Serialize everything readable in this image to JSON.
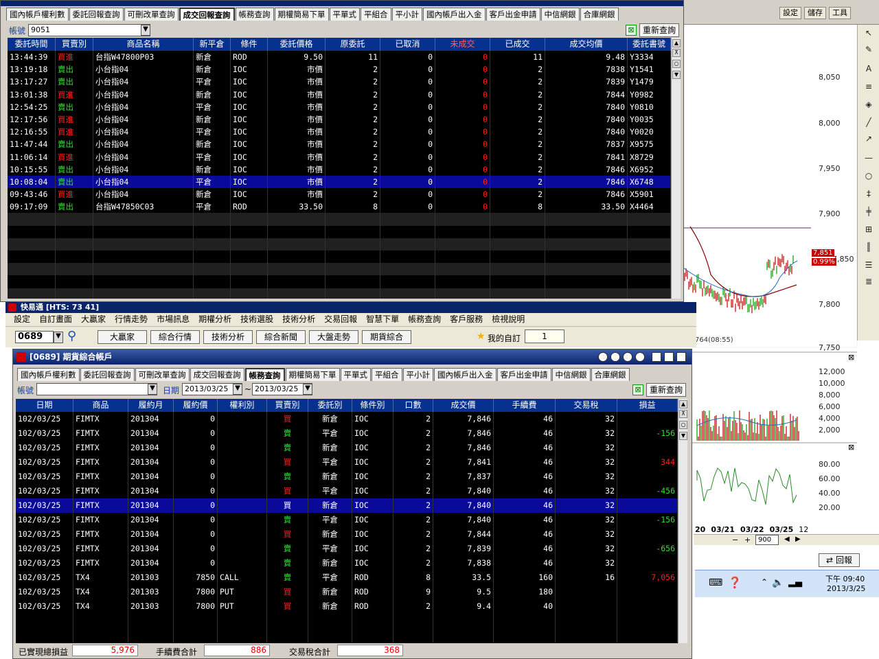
{
  "chart": {
    "toolbar": [
      "設定",
      "儲存",
      "工具"
    ],
    "price_axis": [
      "8,050",
      "8,000",
      "7,950",
      "7,900",
      "7,850",
      "7,800",
      "7,750"
    ],
    "price_tag": "7,851",
    "pct_tag": "0.99%",
    "annot": "764(08:55)",
    "vol_axis": [
      "12,000",
      "10,000",
      "8,000",
      "6,000",
      "4,000",
      "2,000"
    ],
    "osc_axis": [
      "80.00",
      "60.00",
      "40.00",
      "20.00"
    ],
    "dates": [
      "20",
      "03/21",
      "03/22",
      "03/25",
      "12"
    ],
    "zoom_value": "900",
    "return_button": "回報",
    "clock_time": "下午 09:40",
    "clock_date": "2013/3/25",
    "colors": {
      "bear": "#c00000",
      "bull": "#00a000",
      "line": "#8b0000"
    }
  },
  "top": {
    "tabs": [
      "國內帳戶權利數",
      "委託回報查詢",
      "可刪改單查詢",
      "成交回報查詢",
      "帳務查詢",
      "期權簡易下單",
      "平單式",
      "平組合",
      "平小計",
      "國內帳戶出入金",
      "客戶出金申請",
      "中信網銀",
      "合庫網銀"
    ],
    "active_tab": 3,
    "account_label": "帳號",
    "account_value": "9051",
    "requery": "重新查詢",
    "headers": [
      "委託時間",
      "買賣別",
      "商品名稱",
      "新平倉",
      "條件",
      "委託價格",
      "原委託",
      "已取消",
      "未成交",
      "已成交",
      "成交均價",
      "委託書號"
    ],
    "rows": [
      [
        "13:44:39",
        "買進",
        "台指W47800P03",
        "新倉",
        "ROD",
        "9.50",
        "11",
        "0",
        "0",
        "11",
        "9.48",
        "Y3334"
      ],
      [
        "13:19:18",
        "賣出",
        "小台指04",
        "新倉",
        "IOC",
        "市價",
        "2",
        "0",
        "0",
        "2",
        "7838",
        "Y1541"
      ],
      [
        "13:17:27",
        "賣出",
        "小台指04",
        "平倉",
        "IOC",
        "市價",
        "2",
        "0",
        "0",
        "2",
        "7839",
        "Y1479"
      ],
      [
        "13:01:38",
        "買進",
        "小台指04",
        "新倉",
        "IOC",
        "市價",
        "2",
        "0",
        "0",
        "2",
        "7844",
        "Y0982"
      ],
      [
        "12:54:25",
        "賣出",
        "小台指04",
        "平倉",
        "IOC",
        "市價",
        "2",
        "0",
        "0",
        "2",
        "7840",
        "Y0810"
      ],
      [
        "12:17:56",
        "買進",
        "小台指04",
        "新倉",
        "IOC",
        "市價",
        "2",
        "0",
        "0",
        "2",
        "7840",
        "Y0035"
      ],
      [
        "12:16:55",
        "買進",
        "小台指04",
        "平倉",
        "IOC",
        "市價",
        "2",
        "0",
        "0",
        "2",
        "7840",
        "Y0020"
      ],
      [
        "11:47:44",
        "賣出",
        "小台指04",
        "新倉",
        "IOC",
        "市價",
        "2",
        "0",
        "0",
        "2",
        "7837",
        "X9575"
      ],
      [
        "11:06:14",
        "買進",
        "小台指04",
        "平倉",
        "IOC",
        "市價",
        "2",
        "0",
        "0",
        "2",
        "7841",
        "X8729"
      ],
      [
        "10:15:55",
        "賣出",
        "小台指04",
        "新倉",
        "IOC",
        "市價",
        "2",
        "0",
        "0",
        "2",
        "7846",
        "X6952"
      ],
      [
        "10:08:04",
        "賣出",
        "小台指04",
        "平倉",
        "IOC",
        "市價",
        "2",
        "0",
        "0",
        "2",
        "7846",
        "X6748"
      ],
      [
        "09:43:46",
        "買進",
        "小台指04",
        "新倉",
        "IOC",
        "市價",
        "2",
        "0",
        "0",
        "2",
        "7846",
        "X5901"
      ],
      [
        "09:17:09",
        "賣出",
        "台指W47850C03",
        "平倉",
        "ROD",
        "33.50",
        "8",
        "0",
        "0",
        "8",
        "33.50",
        "X4464"
      ]
    ]
  },
  "main": {
    "title": "快易通 [HTS: 73 41]",
    "menu": [
      "設定",
      "自訂畫面",
      "大贏家",
      "行情走勢",
      "市場訊息",
      "期權分析",
      "技術選股",
      "技術分析",
      "交易回報",
      "智慧下單",
      "帳務查詢",
      "客戶服務",
      "檢視說明"
    ],
    "code": "0689",
    "toolbar": [
      "大贏家",
      "綜合行情",
      "技術分析",
      "綜合新聞",
      "大盤走勢",
      "期貨綜合"
    ],
    "favorite": "我的自訂",
    "fav_value": "1"
  },
  "bottom": {
    "title": "[0689] 期貨綜合帳戶",
    "tabs": [
      "國內帳戶權利數",
      "委託回報查詢",
      "可刪改單查詢",
      "成交回報查詢",
      "帳務查詢",
      "期權簡易下單",
      "平單式",
      "平組合",
      "平小計",
      "國內帳戶出入金",
      "客戶出金申請",
      "中信網銀",
      "合庫網銀"
    ],
    "active_tab": 4,
    "account_label": "帳號",
    "date_label": "日期",
    "date_from": "2013/03/25",
    "date_sep": "~",
    "date_to": "2013/03/25",
    "requery": "重新查詢",
    "headers": [
      "日期",
      "商品",
      "履約月",
      "履約價",
      "權利別",
      "買賣別",
      "委託別",
      "條件別",
      "口數",
      "成交價",
      "手續費",
      "交易稅",
      "損益"
    ],
    "rows": [
      [
        "102/03/25",
        "FIMTX",
        "201304",
        "0",
        "",
        "買",
        "新倉",
        "IOC",
        "2",
        "7,846",
        "46",
        "32",
        ""
      ],
      [
        "102/03/25",
        "FIMTX",
        "201304",
        "0",
        "",
        "賣",
        "平倉",
        "IOC",
        "2",
        "7,846",
        "46",
        "32",
        "-156"
      ],
      [
        "102/03/25",
        "FIMTX",
        "201304",
        "0",
        "",
        "賣",
        "新倉",
        "IOC",
        "2",
        "7,846",
        "46",
        "32",
        ""
      ],
      [
        "102/03/25",
        "FIMTX",
        "201304",
        "0",
        "",
        "買",
        "平倉",
        "IOC",
        "2",
        "7,841",
        "46",
        "32",
        "344"
      ],
      [
        "102/03/25",
        "FIMTX",
        "201304",
        "0",
        "",
        "賣",
        "新倉",
        "IOC",
        "2",
        "7,837",
        "46",
        "32",
        ""
      ],
      [
        "102/03/25",
        "FIMTX",
        "201304",
        "0",
        "",
        "買",
        "平倉",
        "IOC",
        "2",
        "7,840",
        "46",
        "32",
        "-456"
      ],
      [
        "102/03/25",
        "FIMTX",
        "201304",
        "0",
        "",
        "買",
        "新倉",
        "IOC",
        "2",
        "7,840",
        "46",
        "32",
        ""
      ],
      [
        "102/03/25",
        "FIMTX",
        "201304",
        "0",
        "",
        "賣",
        "平倉",
        "IOC",
        "2",
        "7,840",
        "46",
        "32",
        "-156"
      ],
      [
        "102/03/25",
        "FIMTX",
        "201304",
        "0",
        "",
        "買",
        "新倉",
        "IOC",
        "2",
        "7,844",
        "46",
        "32",
        ""
      ],
      [
        "102/03/25",
        "FIMTX",
        "201304",
        "0",
        "",
        "賣",
        "平倉",
        "IOC",
        "2",
        "7,839",
        "46",
        "32",
        "-656"
      ],
      [
        "102/03/25",
        "FIMTX",
        "201304",
        "0",
        "",
        "賣",
        "新倉",
        "IOC",
        "2",
        "7,838",
        "46",
        "32",
        ""
      ],
      [
        "102/03/25",
        "TX4",
        "201303",
        "7850",
        "CALL",
        "賣",
        "平倉",
        "ROD",
        "8",
        "33.5",
        "160",
        "16",
        "7,056"
      ],
      [
        "102/03/25",
        "TX4",
        "201303",
        "7800",
        "PUT",
        "買",
        "新倉",
        "ROD",
        "9",
        "9.5",
        "180",
        "",
        ""
      ],
      [
        "102/03/25",
        "TX4",
        "201303",
        "7800",
        "PUT",
        "買",
        "新倉",
        "ROD",
        "2",
        "9.4",
        "40",
        "",
        ""
      ]
    ],
    "footer": {
      "pnl_label": "已實現總損益",
      "pnl": "5,976",
      "fee_label": "手續費合計",
      "fee": "886",
      "tax_label": "交易稅合計",
      "tax": "368"
    }
  }
}
